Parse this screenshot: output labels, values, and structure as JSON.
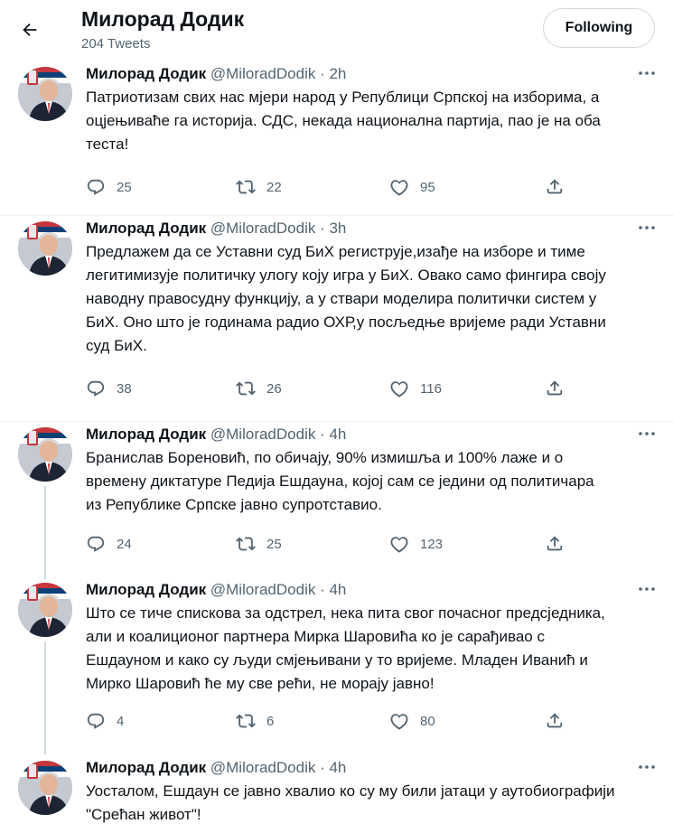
{
  "header": {
    "name": "Милорад Додик",
    "tweet_count": "204 Tweets",
    "follow_label": "Following",
    "back_icon": "arrow-left-icon"
  },
  "tweets": [
    {
      "name": "Милорад Додик",
      "meta": "@MiloradDodik · 2h",
      "text": "Патриотизам свих нас мјери народ у Републици Српској на изборима, а\nоцјењиваће га историја. СДС, некада национална партија, пао је на оба\nтеста!",
      "replies": "25",
      "retweets": "22",
      "likes": "95"
    },
    {
      "name": "Милорад Додик",
      "meta": "@MiloradDodik · 3h",
      "text": "Предлажем да се Уставни суд БиХ региструје,изађе на изборе и тиме\nлегитимизује политичку улогу коју игра у БиХ. Овако само фингира своју\nнаводну правосудну функцију, а у ствари моделира политички систем у\nБиХ. Оно што је годинама радио ОХР,у посљедње вријеме ради Уставни\nсуд БиХ.",
      "replies": "38",
      "retweets": "26",
      "likes": "116"
    },
    {
      "name": "Милорад Додик",
      "meta": "@MiloradDodik · 4h",
      "text": "Бранислав Бореновић, по обичају, 90% измишља и 100% лаже и о\nвремену диктатуре Педија Ешдауна, којој сам се једини од политичара\nиз Републике Српске јавно супротставио.",
      "replies": "24",
      "retweets": "25",
      "likes": "123"
    },
    {
      "name": "Милорад Додик",
      "meta": "@MiloradDodik · 4h",
      "text": "Што се тиче спискова за одстрел, нека пита свог почасног предсједника,\nали и коалиционог партнера Мирка Шаровића ко је сарађивао с\nЕшдауном и како су људи смјењивани у то вријеме. Младен Иванић и\nМирко Шаровић ће му све рећи, не морају јавно!",
      "replies": "4",
      "retweets": "6",
      "likes": "80"
    },
    {
      "name": "Милорад Додик",
      "meta": "@MiloradDodik · 4h",
      "text": "Уосталом, Ешдаун се јавно хвалио ко су му били јатаци у аутобиографији\n\"Срећан живот\"!"
    }
  ],
  "icons": {
    "reply": "reply-icon",
    "retweet": "retweet-icon",
    "like": "heart-icon",
    "share": "share-icon",
    "more": "more-icon"
  },
  "colors": {
    "text": "#0f1419",
    "secondary": "#536471",
    "border": "#cfd9de",
    "divider": "#eff3f4",
    "flag_red": "#c6363c",
    "flag_blue": "#0c4076"
  }
}
